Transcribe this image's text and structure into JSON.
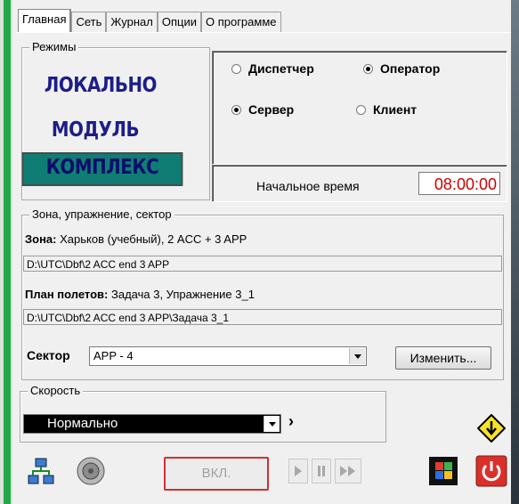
{
  "tabs": [
    {
      "label": "Главная"
    },
    {
      "label": "Сеть"
    },
    {
      "label": "Журнал"
    },
    {
      "label": "Опции"
    },
    {
      "label": "О программе"
    }
  ],
  "modes": {
    "legend": "Режимы",
    "local": "ЛОКАЛЬНО",
    "module": "МОДУЛЬ",
    "complex": "КОМПЛЕКС",
    "dispatcher_label": "Диспетчер",
    "operator_label": "Оператор",
    "server_label": "Сервер",
    "client_label": "Клиент",
    "start_time_label": "Начальное время",
    "start_time_value": "08:00:00"
  },
  "zone_group": {
    "legend": "Зона, упражнение, сектор",
    "zone_label": "Зона:",
    "zone_value": "Харьков (учебный), 2 ACC + 3 APP",
    "zone_path": "D:\\UTC\\Dbf\\2 ACC end 3 APP",
    "plan_label": "План полетов:",
    "plan_value": "Задача 3, Упражнение 3_1",
    "plan_path": "D:\\UTC\\Dbf\\2 ACC end 3 APP\\Задача 3_1",
    "sector_label": "Сектор",
    "sector_value": "APP - 4",
    "change_button": "Изменить..."
  },
  "speed": {
    "legend": "Скорость",
    "value": "Нормально",
    "more": "›"
  },
  "bottom": {
    "on_button": "ВКЛ."
  },
  "colors": {
    "accent_green": "#22a84a",
    "selected_mode": "#0f7d74",
    "time_red": "#cc0000",
    "on_border": "#d03030"
  },
  "icons": [
    "network-icon",
    "speaker-icon",
    "play-icon",
    "pause-icon",
    "fast-forward-icon",
    "windows-icon",
    "power-icon",
    "down-arrow-icon"
  ]
}
